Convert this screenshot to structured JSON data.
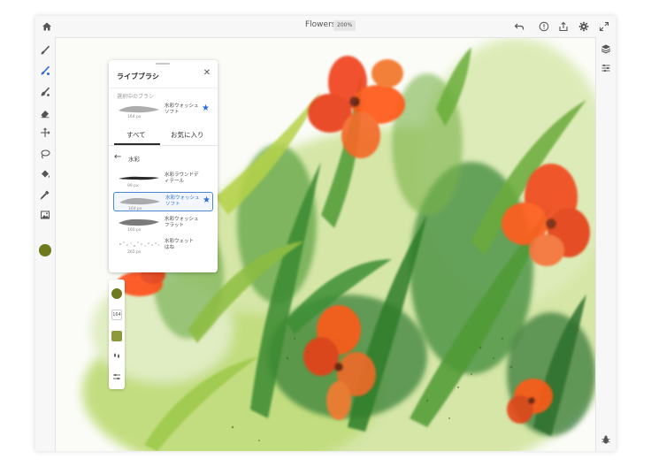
{
  "document": {
    "title": "Flowers",
    "zoom": "200%"
  },
  "colors": {
    "accent": "#2a6dd6",
    "current_brush_color": "#6f7a1e",
    "flow_swatch": "#8e9a3a"
  },
  "topbar": {
    "icons": [
      "home-icon",
      "undo-icon",
      "help-icon",
      "share-icon",
      "gear-icon",
      "fullscreen-icon"
    ]
  },
  "toolbar": {
    "tools": [
      "paint-brush-icon",
      "watercolor-brush-icon",
      "fill-brush-icon",
      "eraser-icon",
      "transform-icon",
      "lasso-icon",
      "paint-bucket-icon",
      "eyedropper-icon",
      "image-icon"
    ]
  },
  "brush_panel": {
    "title": "ライブブラシ",
    "current_section_label": "選択中のブラシ",
    "current_brush": {
      "name": "水彩ウォッシュ ソフト",
      "size": "164 px",
      "favorite": true
    },
    "tabs": [
      {
        "label": "すべて",
        "active": true
      },
      {
        "label": "お気に入り",
        "active": false
      }
    ],
    "category": "水彩",
    "brushes": [
      {
        "name": "水彩ラウンドディテール",
        "size": "99 px",
        "favorite": false,
        "selected": false
      },
      {
        "name": "水彩ウォッシュ ソフト",
        "size": "164 px",
        "favorite": true,
        "selected": true
      },
      {
        "name": "水彩ウォッシュフラット",
        "size": "160 px",
        "favorite": false,
        "selected": false
      },
      {
        "name": "水彩ウェット はね",
        "size": "265 px",
        "favorite": false,
        "selected": false
      }
    ]
  },
  "properties": {
    "size_value": "164"
  }
}
